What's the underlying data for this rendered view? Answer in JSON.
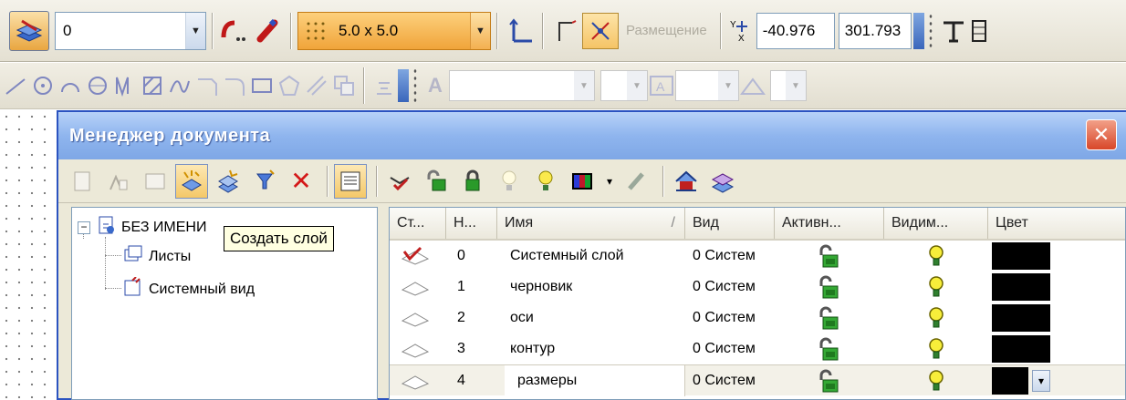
{
  "toolbar": {
    "layer_value": "0",
    "grid_value": "5.0 x 5.0",
    "placement_label": "Размещение",
    "coord_x": "-40.976",
    "coord_y": "301.793"
  },
  "dialog": {
    "title": "Менеджер документа",
    "close_glyph": "✕"
  },
  "tree": {
    "root_label": "БЕЗ ИМЕНИ",
    "sheets_label": "Листы",
    "view_label": "Системный вид",
    "tooltip": "Создать слой"
  },
  "table": {
    "headers": [
      "Ст...",
      "Н...",
      "Имя",
      "/",
      "Вид",
      "Активн...",
      "Видим...",
      "Цвет"
    ],
    "rows": [
      {
        "num": "0",
        "name": "Системный слой",
        "view": "0 Систем"
      },
      {
        "num": "1",
        "name": "черновик",
        "view": "0 Систем"
      },
      {
        "num": "2",
        "name": "оси",
        "view": "0 Систем"
      },
      {
        "num": "3",
        "name": "контур",
        "view": "0 Систем"
      },
      {
        "num": "4",
        "name": "размеры",
        "view": "0 Систем"
      }
    ]
  },
  "icons": [
    "layers-icon",
    "magnet-icon",
    "grid-icon",
    "axis-icon",
    "polyline-icon",
    "placement-icon",
    "text-tool-icon",
    "create-layer-icon",
    "delete-icon",
    "lamp-icon",
    "lock-icon",
    "close-icon"
  ],
  "colors": {
    "title_bar": "#7ea7e6",
    "close_button": "#d8472a",
    "orange_combo": "#f0a43a",
    "swatch": "#000000"
  }
}
